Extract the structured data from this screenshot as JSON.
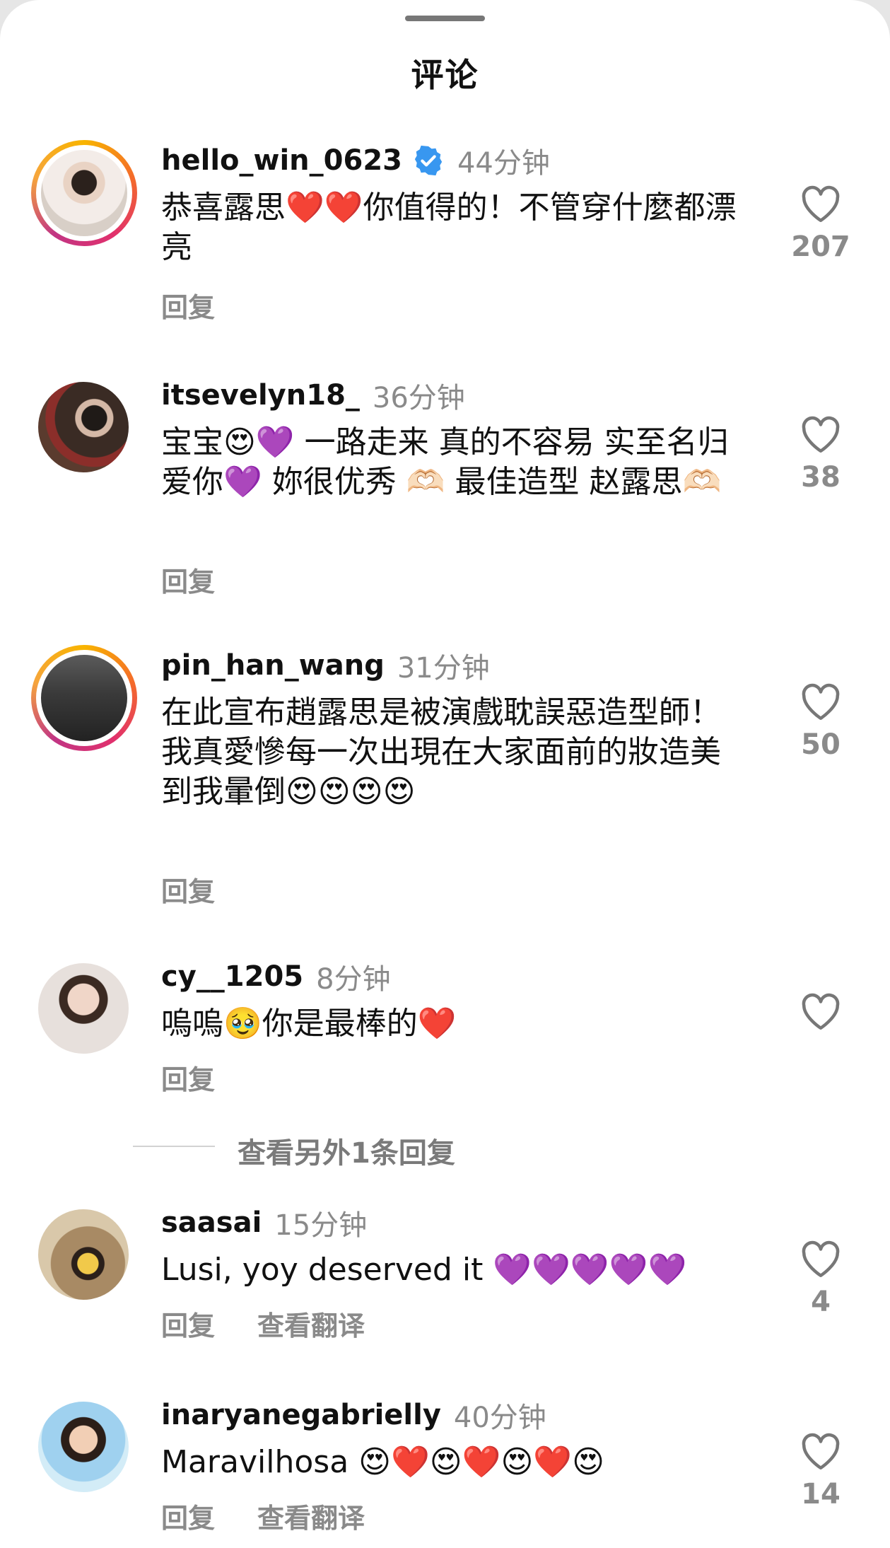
{
  "header": {
    "title": "评论"
  },
  "comments": [
    {
      "username": "hello_win_0623",
      "verified": true,
      "time": "44分钟",
      "text": "恭喜露思❤️❤️你值得的！不管穿什麼都漂亮",
      "likes": "207",
      "reply_label": "回复",
      "has_story_ring": true,
      "avatar_icon": "woman-photo"
    },
    {
      "username": "itsevelyn18_",
      "time": "36分钟",
      "text": "宝宝😍💜 一路走来 真的不容易 实至名归 爱你💜 妳很优秀 🫶🏻 最佳造型 赵露思🫶🏻",
      "likes": "38",
      "reply_label": "回复",
      "has_story_ring": false,
      "avatar_icon": "woman-roses-photo"
    },
    {
      "username": "pin_han_wang",
      "time": "31分钟",
      "text": "在此宣布趙露思是被演戲耽誤惡造型師！\n我真愛慘每一次出現在大家面前的妝造美到我暈倒😍😍😍😍",
      "likes": "50",
      "reply_label": "回复",
      "has_story_ring": true,
      "avatar_icon": "street-photo"
    },
    {
      "username": "cy__1205",
      "time": "8分钟",
      "text": "嗚嗚🥹你是最棒的❤️",
      "likes": "",
      "reply_label": "回复",
      "has_story_ring": false,
      "avatar_icon": "woman-glasses-photo"
    },
    {
      "username": "saasai",
      "time": "15分钟",
      "text": "Lusi, yoy deserved it 💜💜💜💜💜",
      "likes": "4",
      "reply_label": "回复",
      "translate_label": "查看翻译",
      "has_story_ring": false,
      "avatar_icon": "woman-arches-photo"
    },
    {
      "username": "inaryanegabrielly",
      "time": "40分钟",
      "text": "Maravilhosa 😍❤️😍❤️😍❤️😍",
      "likes": "14",
      "reply_label": "回复",
      "translate_label": "查看翻译",
      "has_story_ring": false,
      "avatar_icon": "child-photo"
    }
  ],
  "more_replies": {
    "label": "查看另外1条回复"
  },
  "colors": {
    "secondary_text": "#8a8a8a",
    "verified_blue": "#3897f0",
    "ring_gradient": [
      "#f8b400",
      "#e1306c",
      "#c13584"
    ]
  }
}
